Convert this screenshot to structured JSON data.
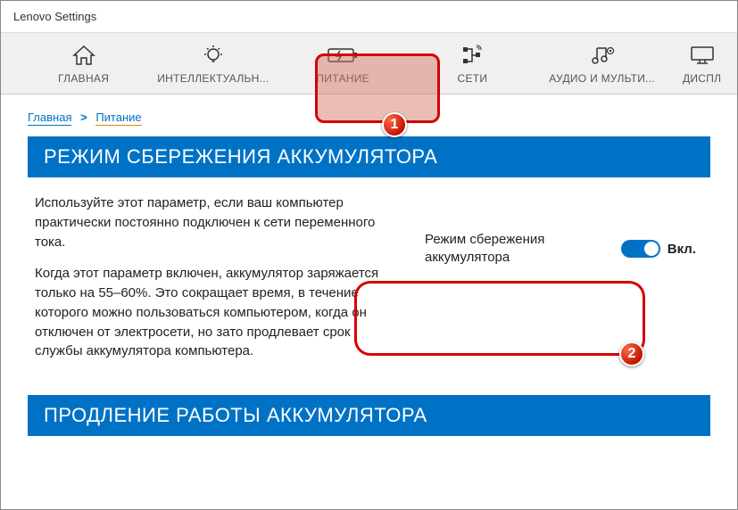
{
  "window": {
    "title": "Lenovo Settings"
  },
  "tabs": [
    {
      "label": "ГЛАВНАЯ",
      "icon": "home"
    },
    {
      "label": "ИНТЕЛЛЕКТУАЛЬН...",
      "icon": "bulb"
    },
    {
      "label": "ПИТАНИЕ",
      "icon": "battery",
      "active": true
    },
    {
      "label": "СЕТИ",
      "icon": "network"
    },
    {
      "label": "АУДИО И МУЛЬТИ...",
      "icon": "audio"
    },
    {
      "label": "ДИСПЛ",
      "icon": "display"
    }
  ],
  "breadcrumb": {
    "home": "Главная",
    "sep": ">",
    "current": "Питание"
  },
  "section1": {
    "title": "РЕЖИМ СБЕРЕЖЕНИЯ АККУМУЛЯТОРА",
    "para1": "Используйте этот параметр, если ваш компьютер практически постоянно подключен к сети переменного тока.",
    "para2": "Когда этот параметр включен, аккумулятор заряжается только на 55–60%. Это сокращает время, в течение которого можно пользоваться компьютером, когда он отключен от электросети, но зато продлевает срок службы аккумулятора компьютера.",
    "toggle_label": "Режим сбережения аккумулятора",
    "toggle_state": "Вкл."
  },
  "section2": {
    "title": "ПРОДЛЕНИЕ РАБОТЫ АККУМУЛЯТОРА"
  },
  "annotations": {
    "b1": "1",
    "b2": "2"
  }
}
